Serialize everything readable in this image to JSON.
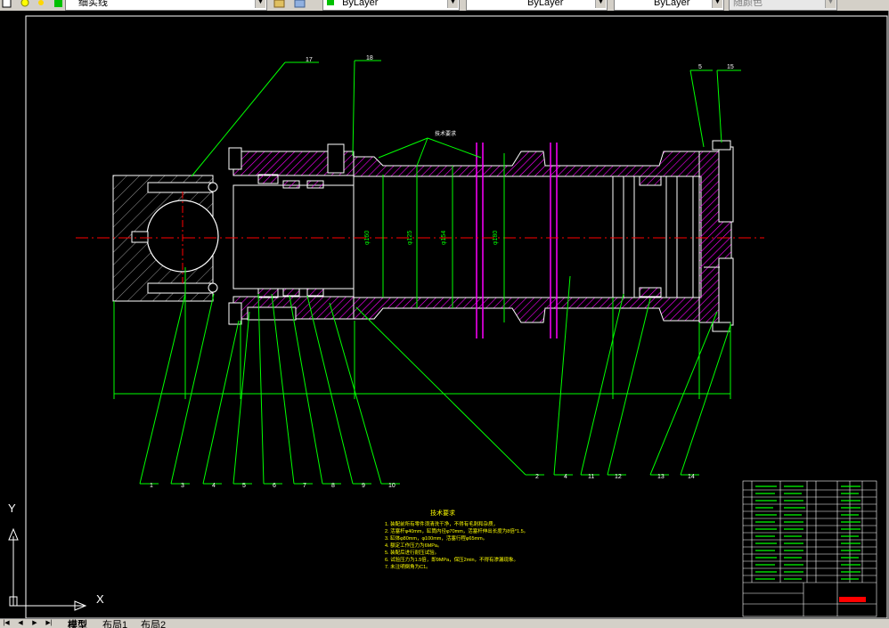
{
  "toolbar": {
    "layer_name": "细实线",
    "color_value": "ByLayer",
    "linetype_value": "ByLayer",
    "lineweight_value": "ByLayer",
    "plotstyle_value": "随颜色"
  },
  "colors": {
    "background": "#000000",
    "green_lines": "#00ff00",
    "hatch": "#ff00ff",
    "centerline": "#ff0000",
    "white_lines": "#ffffff",
    "yellow_text": "#ffff00"
  },
  "drawing": {
    "part_callouts_top": [
      "17",
      "18",
      "5",
      "15"
    ],
    "part_callouts_bottom": [
      "1",
      "3",
      "4",
      "5",
      "6",
      "7",
      "8",
      "9",
      "10",
      "2",
      "4",
      "11",
      "12",
      "13",
      "14"
    ],
    "dimensions": [
      "φ160",
      "φ125",
      "φ154",
      "φ180"
    ],
    "annotation_top": "技术要求",
    "tech_req_title": "技术要求",
    "tech_req_lines": [
      "1. 装配前所有零件须清洗干净，不得有毛刺和杂质，",
      "2. 活塞杆φ40mm，缸筒内径φ70mm，活塞杆伸出长度为8倍*1.5。",
      "3. 缸体φ80mm，φ100mm，活塞行程φ65mm。",
      "4. 额定工作压力为6MPa。",
      "5. 装配后进行耐压试验。",
      "6. 试验压力为1.5倍，即9MPa，保压2min，不得有渗漏现象。",
      "7. 未注明倒角为C1。"
    ]
  },
  "ucs": {
    "y_label": "Y",
    "x_label": "X"
  },
  "tabs": {
    "model": "模型",
    "layout1": "布局1",
    "layout2": "布局2"
  }
}
